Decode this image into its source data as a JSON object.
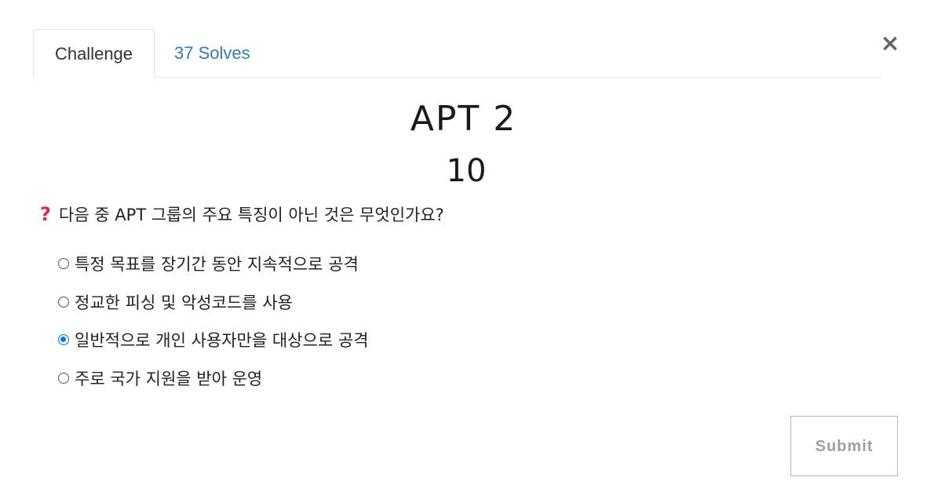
{
  "modal": {
    "close_symbol": "×"
  },
  "tabs": [
    {
      "label": "Challenge",
      "active": true
    },
    {
      "label": "37 Solves",
      "active": false
    }
  ],
  "challenge": {
    "name": "APT 2",
    "value": "10"
  },
  "question": {
    "icon": "question-mark-icon",
    "icon_glyph": "?",
    "text": "다음 중 APT 그룹의 주요 특징이 아닌 것은 무엇인가요?",
    "icon_color": "#e0245e"
  },
  "options": [
    {
      "label": "특정 목표를 장기간 동안 지속적으로 공격",
      "checked": false
    },
    {
      "label": "정교한 피싱 및 악성코드를 사용",
      "checked": false
    },
    {
      "label": "일반적으로 개인 사용자만을 대상으로 공격",
      "checked": true
    },
    {
      "label": "주로 국가 지원을 받아 운영",
      "checked": false
    }
  ],
  "submit": {
    "label": "Submit"
  },
  "colors": {
    "link": "#337ab7",
    "radio_checked": "#0075ff",
    "submit_text": "#a0a0a0"
  }
}
